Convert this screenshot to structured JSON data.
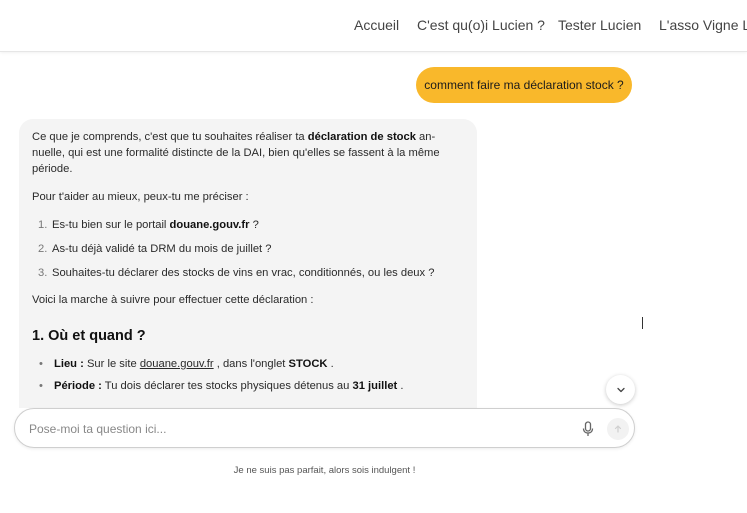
{
  "nav": {
    "items": [
      "Accueil",
      "C'est qu(o)i Lucien ?",
      "Tester Lucien",
      "L'asso Vigne Li"
    ]
  },
  "chat": {
    "user_message": "comment faire ma déclaration stock ?",
    "bot": {
      "p1_a": "Ce que je comprends, c'est que tu souhaites réaliser ta ",
      "p1_b": "déclaration de stock",
      "p1_c": " an-nuelle, qui est une formalité distincte de la DAI, bien qu'elles se fassent à la même période.",
      "p2": "Pour t'aider au mieux, peux-tu me préciser :",
      "list": [
        {
          "num": "1.",
          "pre": "Es-tu bien sur le portail ",
          "bold": "douane.gouv.fr",
          "post": " ?"
        },
        {
          "num": "2.",
          "pre": "As-tu déjà validé ta DRM du mois de juillet ?",
          "bold": "",
          "post": ""
        },
        {
          "num": "3.",
          "pre": "Souhaites-tu déclarer des stocks de vins en vrac, conditionnés, ou les deux ?",
          "bold": "",
          "post": ""
        }
      ],
      "p3": "Voici la marche à suivre pour effectuer cette déclaration :",
      "section_title": "1. Où et quand ?",
      "bullets": [
        {
          "label": "Lieu :",
          "pre": " Sur le site ",
          "link": "douane.gouv.fr",
          "mid": " , dans l'onglet ",
          "bold": "STOCK",
          "post": " ."
        },
        {
          "label": "Période :",
          "pre": " Tu dois déclarer tes stocks physiques détenus au ",
          "link": "",
          "mid": "",
          "bold": "31 juillet",
          "post": " ."
        }
      ]
    }
  },
  "input": {
    "placeholder": "Pose-moi ta question ici..."
  },
  "disclaimer": "Je ne suis pas parfait, alors sois indulgent !",
  "colors": {
    "user_bubble": "#f9b82b",
    "bot_bubble": "#f4f4f4"
  },
  "icons": {
    "mic": "microphone-icon",
    "send": "send-icon",
    "scroll": "chevron-down-icon"
  }
}
